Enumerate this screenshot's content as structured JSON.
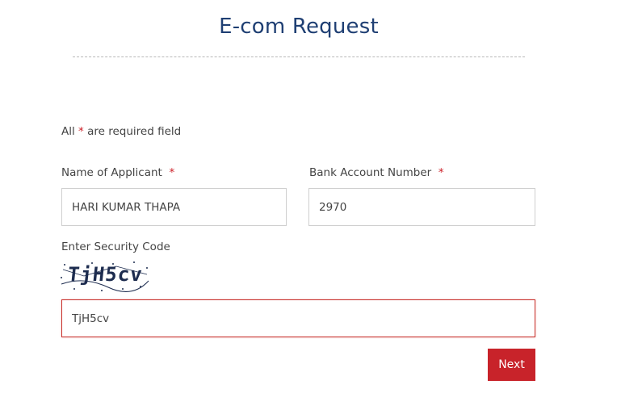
{
  "header": {
    "title": "E-com Request"
  },
  "form": {
    "required_note_prefix": "All",
    "required_marker": "*",
    "required_note_suffix": "are required field",
    "applicant": {
      "label": "Name of Applicant",
      "value": "HARI KUMAR THAPA"
    },
    "account": {
      "label": "Bank Account Number",
      "value": "2970"
    },
    "security": {
      "label": "Enter Security Code",
      "captcha_text": "TjH5cv",
      "value": "TjH5cv"
    },
    "next_label": "Next"
  },
  "colors": {
    "title": "#1f3f73",
    "accent_red": "#c8232a"
  }
}
